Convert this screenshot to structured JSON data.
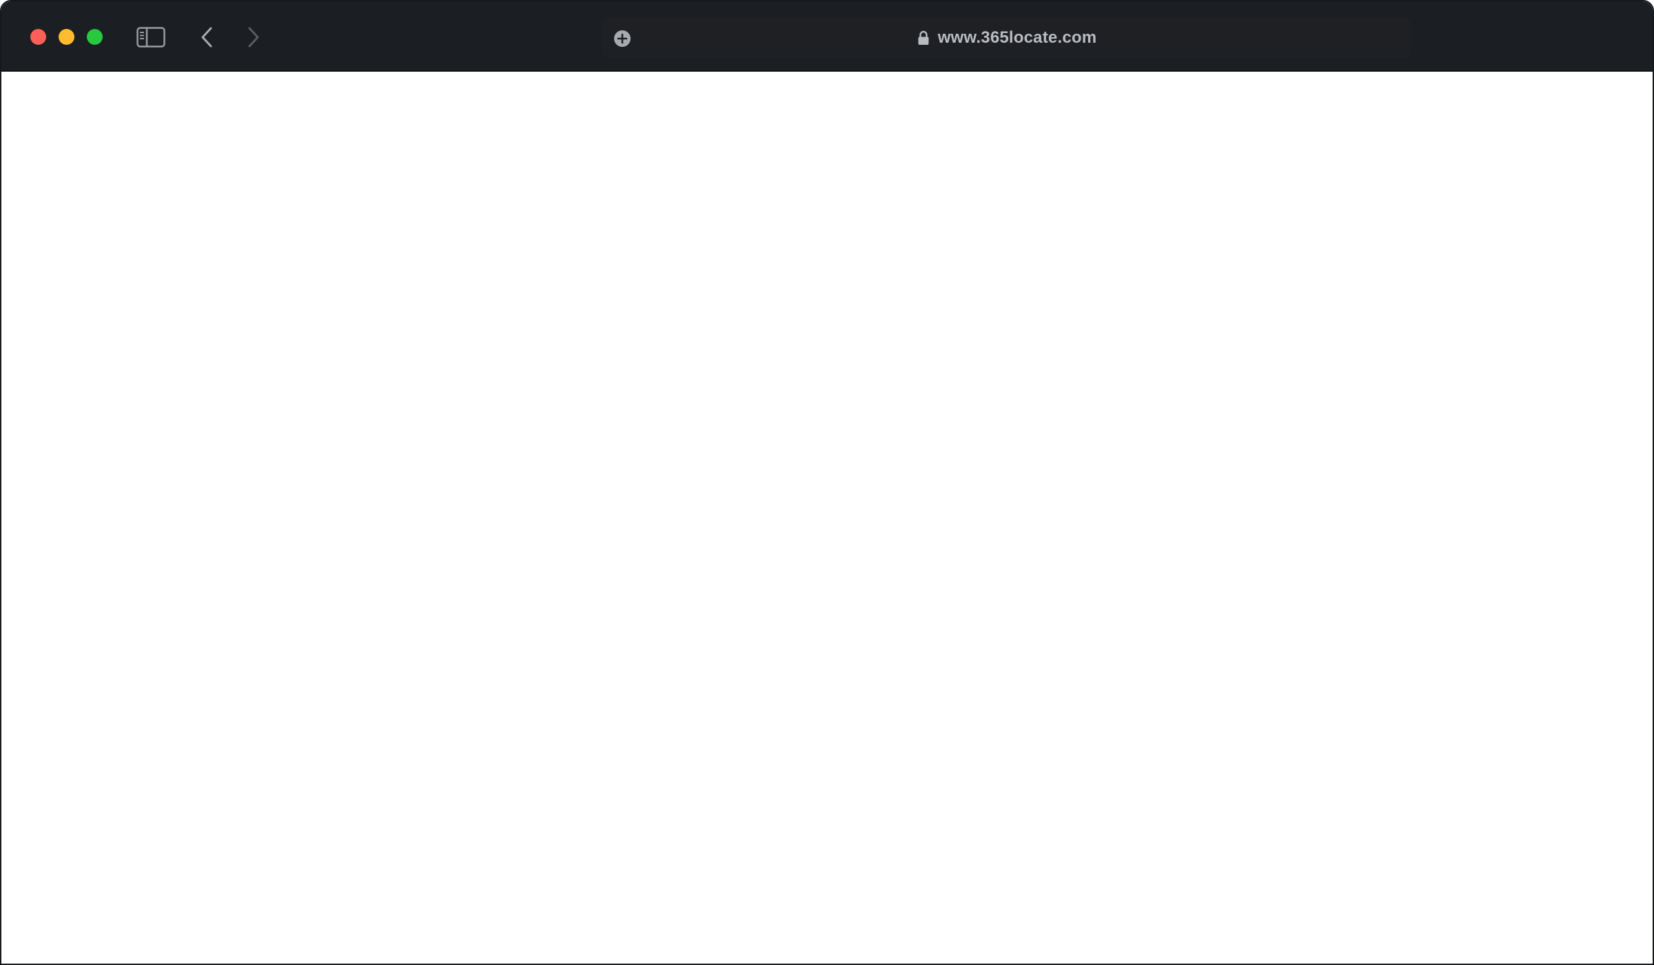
{
  "browser": {
    "address_bar": {
      "url": "www.365locate.com"
    },
    "icons": {
      "sidebar": "sidebar-toggle-icon",
      "back": "chevron-left-icon",
      "forward": "chevron-right-icon",
      "site_settings": "plus-circle-icon",
      "lock": "lock-icon"
    },
    "traffic_lights": {
      "close_color": "#fe5f57",
      "minimize_color": "#febc2e",
      "zoom_color": "#28c840"
    },
    "colors": {
      "toolbar_bg": "#1b1e22",
      "address_bg": "#1e2024",
      "url_text": "#b8bbc0",
      "content_bg": "#ffffff"
    }
  }
}
